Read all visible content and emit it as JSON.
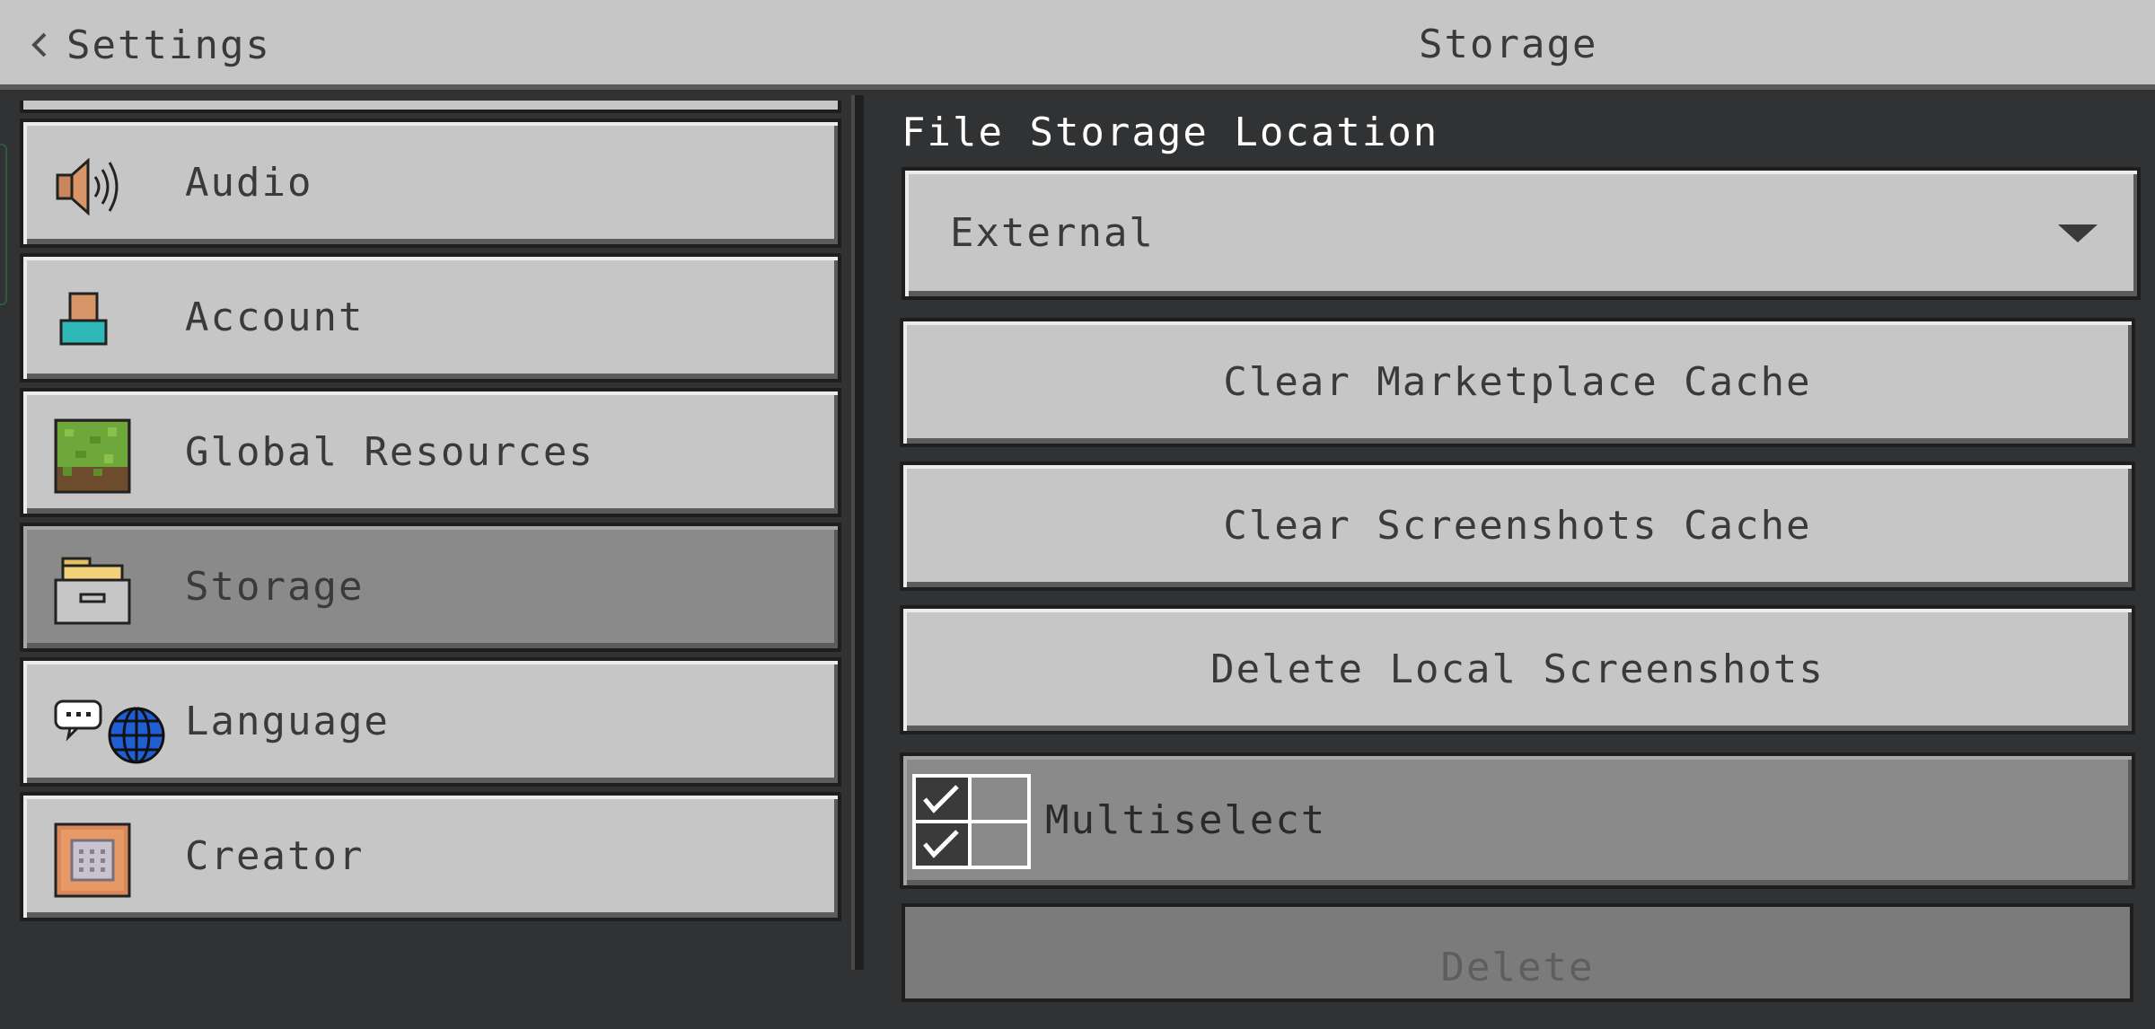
{
  "header": {
    "back_label": "Settings",
    "title": "Storage"
  },
  "nav": {
    "items": [
      {
        "label": "Audio",
        "icon": "speaker-icon"
      },
      {
        "label": "Account",
        "icon": "account-icon"
      },
      {
        "label": "Global Resources",
        "icon": "grass-block-icon"
      },
      {
        "label": "Storage",
        "icon": "storage-box-icon",
        "selected": true
      },
      {
        "label": "Language",
        "icon": "language-globe-icon"
      },
      {
        "label": "Creator",
        "icon": "command-block-icon"
      }
    ]
  },
  "main": {
    "file_storage_label": "File Storage Location",
    "file_storage_value": "External",
    "clear_marketplace_label": "Clear Marketplace Cache",
    "clear_screenshots_label": "Clear Screenshots Cache",
    "delete_local_label": "Delete Local Screenshots",
    "multiselect_label": "Multiselect",
    "delete_label": "Delete"
  },
  "colors": {
    "panel": "#c6c6c6",
    "selected": "#8a8a8a",
    "background": "#313233",
    "globe_blue": "#1f5fd6",
    "account_teal": "#2fb8b8"
  }
}
